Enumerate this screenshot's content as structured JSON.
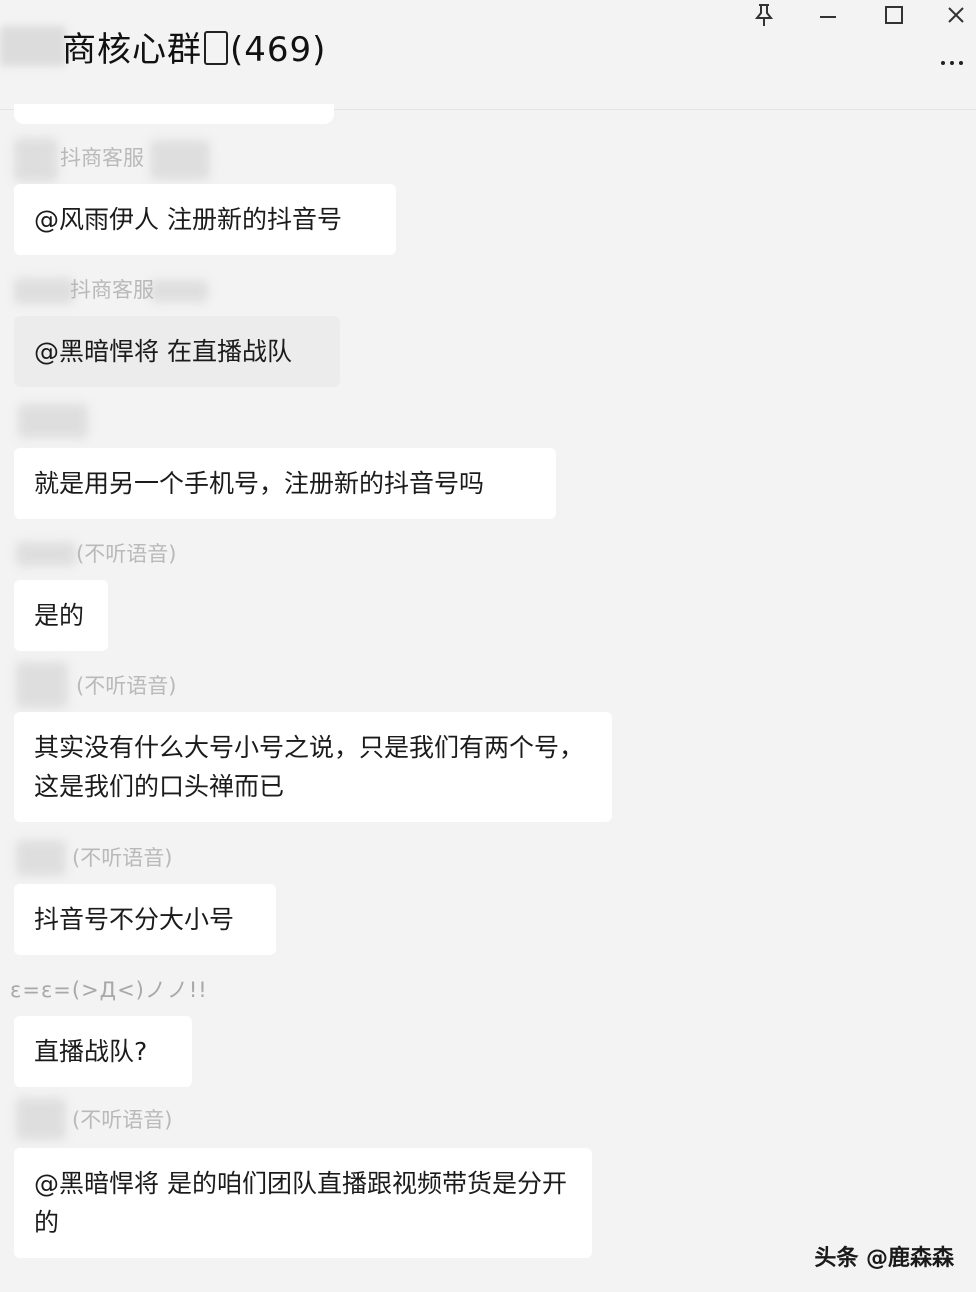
{
  "window": {
    "title": "商核心群",
    "title_tail": "(469)"
  },
  "messages": [
    {
      "sender": "抖商客服",
      "text": "@风雨伊人 注册新的抖音号"
    },
    {
      "sender": "抖商客服",
      "text": "@黑暗悍将 在直播战队"
    },
    {
      "sender": "",
      "text": "就是用另一个手机号，注册新的抖音号吗"
    },
    {
      "sender": "(不听语音)",
      "text": "是的"
    },
    {
      "sender": "(不听语音)",
      "text": "其实没有什么大号小号之说，只是我们有两个号，这是我们的口头禅而已"
    },
    {
      "sender": "(不听语音)",
      "text": "抖音号不分大小号"
    },
    {
      "sender": "ε=ε=(>Д<)ノノ!!",
      "text": "直播战队?"
    },
    {
      "sender": "(不听语音)",
      "text": "@黑暗悍将 是的咱们团队直播跟视频带货是分开的"
    }
  ],
  "watermark": "头条 @鹿森森",
  "colors": {
    "background": "#f3f3f3",
    "bubble": "#ffffff",
    "sender_text": "#b9b9b9"
  }
}
